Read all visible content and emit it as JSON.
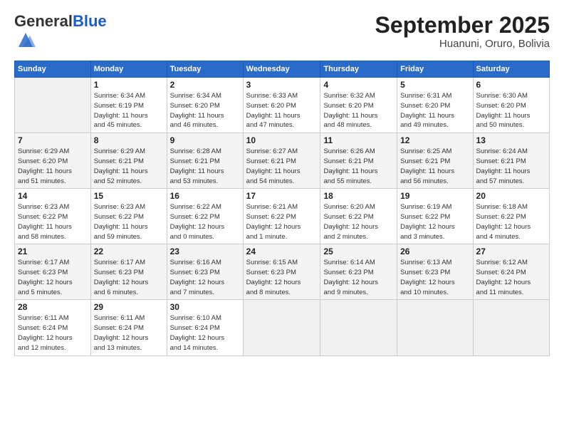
{
  "logo": {
    "general": "General",
    "blue": "Blue"
  },
  "title": "September 2025",
  "subtitle": "Huanuni, Oruro, Bolivia",
  "days_of_week": [
    "Sunday",
    "Monday",
    "Tuesday",
    "Wednesday",
    "Thursday",
    "Friday",
    "Saturday"
  ],
  "weeks": [
    [
      {
        "day": "",
        "info": ""
      },
      {
        "day": "1",
        "info": "Sunrise: 6:34 AM\nSunset: 6:19 PM\nDaylight: 11 hours\nand 45 minutes."
      },
      {
        "day": "2",
        "info": "Sunrise: 6:34 AM\nSunset: 6:20 PM\nDaylight: 11 hours\nand 46 minutes."
      },
      {
        "day": "3",
        "info": "Sunrise: 6:33 AM\nSunset: 6:20 PM\nDaylight: 11 hours\nand 47 minutes."
      },
      {
        "day": "4",
        "info": "Sunrise: 6:32 AM\nSunset: 6:20 PM\nDaylight: 11 hours\nand 48 minutes."
      },
      {
        "day": "5",
        "info": "Sunrise: 6:31 AM\nSunset: 6:20 PM\nDaylight: 11 hours\nand 49 minutes."
      },
      {
        "day": "6",
        "info": "Sunrise: 6:30 AM\nSunset: 6:20 PM\nDaylight: 11 hours\nand 50 minutes."
      }
    ],
    [
      {
        "day": "7",
        "info": "Sunrise: 6:29 AM\nSunset: 6:20 PM\nDaylight: 11 hours\nand 51 minutes."
      },
      {
        "day": "8",
        "info": "Sunrise: 6:29 AM\nSunset: 6:21 PM\nDaylight: 11 hours\nand 52 minutes."
      },
      {
        "day": "9",
        "info": "Sunrise: 6:28 AM\nSunset: 6:21 PM\nDaylight: 11 hours\nand 53 minutes."
      },
      {
        "day": "10",
        "info": "Sunrise: 6:27 AM\nSunset: 6:21 PM\nDaylight: 11 hours\nand 54 minutes."
      },
      {
        "day": "11",
        "info": "Sunrise: 6:26 AM\nSunset: 6:21 PM\nDaylight: 11 hours\nand 55 minutes."
      },
      {
        "day": "12",
        "info": "Sunrise: 6:25 AM\nSunset: 6:21 PM\nDaylight: 11 hours\nand 56 minutes."
      },
      {
        "day": "13",
        "info": "Sunrise: 6:24 AM\nSunset: 6:21 PM\nDaylight: 11 hours\nand 57 minutes."
      }
    ],
    [
      {
        "day": "14",
        "info": "Sunrise: 6:23 AM\nSunset: 6:22 PM\nDaylight: 11 hours\nand 58 minutes."
      },
      {
        "day": "15",
        "info": "Sunrise: 6:23 AM\nSunset: 6:22 PM\nDaylight: 11 hours\nand 59 minutes."
      },
      {
        "day": "16",
        "info": "Sunrise: 6:22 AM\nSunset: 6:22 PM\nDaylight: 12 hours\nand 0 minutes."
      },
      {
        "day": "17",
        "info": "Sunrise: 6:21 AM\nSunset: 6:22 PM\nDaylight: 12 hours\nand 1 minute."
      },
      {
        "day": "18",
        "info": "Sunrise: 6:20 AM\nSunset: 6:22 PM\nDaylight: 12 hours\nand 2 minutes."
      },
      {
        "day": "19",
        "info": "Sunrise: 6:19 AM\nSunset: 6:22 PM\nDaylight: 12 hours\nand 3 minutes."
      },
      {
        "day": "20",
        "info": "Sunrise: 6:18 AM\nSunset: 6:22 PM\nDaylight: 12 hours\nand 4 minutes."
      }
    ],
    [
      {
        "day": "21",
        "info": "Sunrise: 6:17 AM\nSunset: 6:23 PM\nDaylight: 12 hours\nand 5 minutes."
      },
      {
        "day": "22",
        "info": "Sunrise: 6:17 AM\nSunset: 6:23 PM\nDaylight: 12 hours\nand 6 minutes."
      },
      {
        "day": "23",
        "info": "Sunrise: 6:16 AM\nSunset: 6:23 PM\nDaylight: 12 hours\nand 7 minutes."
      },
      {
        "day": "24",
        "info": "Sunrise: 6:15 AM\nSunset: 6:23 PM\nDaylight: 12 hours\nand 8 minutes."
      },
      {
        "day": "25",
        "info": "Sunrise: 6:14 AM\nSunset: 6:23 PM\nDaylight: 12 hours\nand 9 minutes."
      },
      {
        "day": "26",
        "info": "Sunrise: 6:13 AM\nSunset: 6:23 PM\nDaylight: 12 hours\nand 10 minutes."
      },
      {
        "day": "27",
        "info": "Sunrise: 6:12 AM\nSunset: 6:24 PM\nDaylight: 12 hours\nand 11 minutes."
      }
    ],
    [
      {
        "day": "28",
        "info": "Sunrise: 6:11 AM\nSunset: 6:24 PM\nDaylight: 12 hours\nand 12 minutes."
      },
      {
        "day": "29",
        "info": "Sunrise: 6:11 AM\nSunset: 6:24 PM\nDaylight: 12 hours\nand 13 minutes."
      },
      {
        "day": "30",
        "info": "Sunrise: 6:10 AM\nSunset: 6:24 PM\nDaylight: 12 hours\nand 14 minutes."
      },
      {
        "day": "",
        "info": ""
      },
      {
        "day": "",
        "info": ""
      },
      {
        "day": "",
        "info": ""
      },
      {
        "day": "",
        "info": ""
      }
    ]
  ]
}
